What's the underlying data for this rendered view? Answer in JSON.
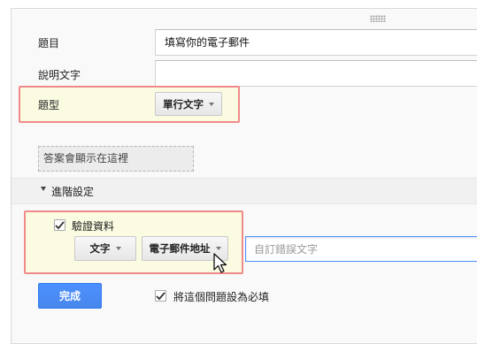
{
  "form": {
    "title_label": "題目",
    "title_value": "填寫你的電子郵件",
    "desc_label": "說明文字",
    "desc_value": "",
    "type_label": "題型",
    "type_value": "單行文字",
    "answer_placeholder": "答案會顯示在這裡",
    "advanced_label": "進階設定",
    "validate_label": "驗證資料",
    "validate_checked": true,
    "validate_type": "文字",
    "validate_rule": "電子郵件地址",
    "error_placeholder": "自訂錯誤文字",
    "done_label": "完成",
    "required_label": "將這個問題設為必填",
    "required_checked": true
  },
  "colors": {
    "highlight_border": "#f08a8a",
    "highlight_fill": "#fbfbe1",
    "primary_button": "#4d90fe"
  }
}
